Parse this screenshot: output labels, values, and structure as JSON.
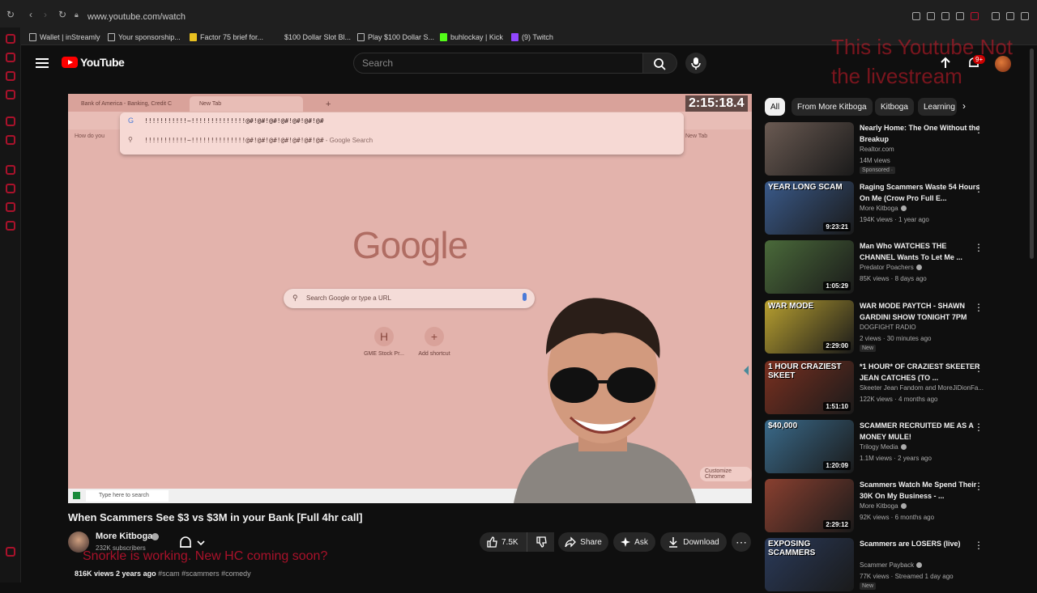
{
  "browser": {
    "url": "www.youtube.com/watch",
    "bookmarks": [
      "Wallet | inStreamly",
      "Your sponsorship...",
      "Factor 75 brief for...",
      "$100 Dollar Slot Bl...",
      "Play $100 Dollar S...",
      "buhlockay | Kick",
      "(9) Twitch"
    ]
  },
  "header": {
    "logo_text": "YouTube",
    "search_placeholder": "Search",
    "notification_count": "9+",
    "overlay_text": "This is Youtube Not the livestream"
  },
  "player": {
    "timer": "2:15:18.4",
    "inner_tabs": [
      "Bank of America - Banking, Credit C",
      "New Tab"
    ],
    "omnibox_text": "!!!!!!!!!!!~!!!!!!!!!!!!!!@#!@#!@#!@#!@#!@#!@#",
    "omnibox_suggestion": "!!!!!!!!!!!~!!!!!!!!!!!!!!@#!@#!@#!@#!@#!@#!@#",
    "omnibox_suggestion_suffix": " - Google Search",
    "inner_bookmark": "How do you",
    "inner_newtab_right": "New Tab",
    "google_logo": "Google",
    "google_search_placeholder": "Search Google or type a URL",
    "shortcuts": [
      {
        "icon": "H",
        "label": "GME Stock Pr..."
      },
      {
        "icon": "+",
        "label": "Add shortcut"
      }
    ],
    "customize_label": "Customize Chrome",
    "taskbar_search": "Type here to search"
  },
  "video": {
    "title": "When Scammers See $3 vs $3M in your Bank [Full 4hr call]",
    "channel": "More Kitboga",
    "subscribers": "232K subscribers",
    "streamer_overlay": "Snorkle is working. New HC coming soon?",
    "likes": "7.5K",
    "share_label": "Share",
    "ask_label": "Ask",
    "download_label": "Download",
    "views_date": "816K views  2 years ago",
    "tags": "#scam #scammers #comedy"
  },
  "chips": [
    "All",
    "From More Kitboga",
    "Kitboga",
    "Learning"
  ],
  "recommendations": [
    {
      "title": "Nearly Home: The One Without the Breakup",
      "channel": "Realtor.com",
      "meta": "14M views",
      "badge": "Sponsored ·",
      "duration": "",
      "thumb_text": "",
      "verified": false,
      "thumb_color": "#6a5a52"
    },
    {
      "title": "Raging Scammers Waste 54 Hours On Me (Crow Pro Full E...",
      "channel": "More Kitboga",
      "meta": "194K views · 1 year ago",
      "badge": "",
      "duration": "9:23:21",
      "thumb_text": "YEAR LONG SCAM",
      "verified": true,
      "thumb_color": "#3a5a8a"
    },
    {
      "title": "Man Who WATCHES THE CHANNEL Wants To Let Me ...",
      "channel": "Predator Poachers",
      "meta": "85K views · 8 days ago",
      "badge": "",
      "duration": "1:05:29",
      "thumb_text": "",
      "verified": true,
      "thumb_color": "#4a6a3a"
    },
    {
      "title": "WAR MODE PAYTCH - SHAWN GARDINI SHOW TONIGHT 7PM",
      "channel": "DOGFIGHT RADIO",
      "meta": "2 views · 30 minutes ago",
      "badge": "New",
      "duration": "2:29:00",
      "thumb_text": "WAR MODE",
      "verified": false,
      "thumb_color": "#b8a030"
    },
    {
      "title": "*1 HOUR* OF CRAZIEST SKEETER JEAN CATCHES (TO ...",
      "channel": "Skeeter Jean Fandom and MoreJiDionFa...",
      "meta": "122K views · 4 months ago",
      "badge": "",
      "duration": "1:51:10",
      "thumb_text": "1 HOUR CRAZIEST SKEET",
      "verified": false,
      "thumb_color": "#7a3020"
    },
    {
      "title": "SCAMMER RECRUITED ME AS A MONEY MULE!",
      "channel": "Trilogy Media",
      "meta": "1.1M views · 2 years ago",
      "badge": "",
      "duration": "1:20:09",
      "thumb_text": "$40,000",
      "verified": true,
      "thumb_color": "#3a6a8a"
    },
    {
      "title": "Scammers Watch Me Spend Their 30K On My Business - ...",
      "channel": "More Kitboga",
      "meta": "92K views · 6 months ago",
      "badge": "",
      "duration": "2:29:12",
      "thumb_text": "",
      "verified": true,
      "thumb_color": "#8a4030"
    },
    {
      "title": "Scammers are LOSERS (live)",
      "channel": "Scammer Payback",
      "meta": "77K views · Streamed 1 day ago",
      "badge": "New",
      "duration": "",
      "thumb_text": "EXPOSING SCAMMERS",
      "verified": true,
      "thumb_color": "#2a3a5a"
    }
  ],
  "colors": {
    "accent": "#ff0000",
    "overlay_red": "#c4122f",
    "background": "#0f0f0f"
  }
}
